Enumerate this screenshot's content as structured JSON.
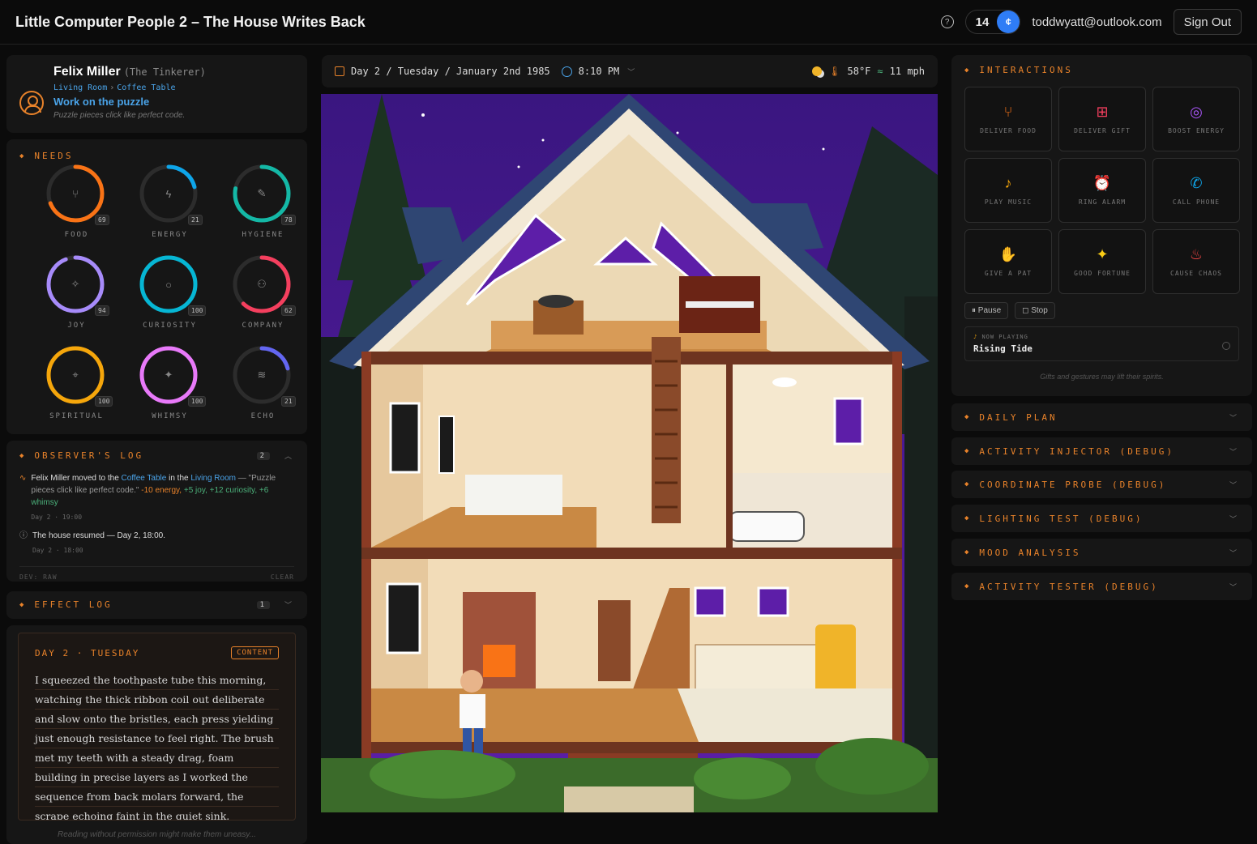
{
  "app": {
    "title": "Little Computer People 2 – The House Writes Back",
    "credits": "14",
    "coin_symbol": "¢",
    "email": "toddwyatt@outlook.com",
    "signout_label": "Sign Out"
  },
  "character": {
    "name": "Felix Miller",
    "role": "(The Tinkerer)",
    "room": "Living Room",
    "object": "Coffee Table",
    "task": "Work on the puzzle",
    "thought": "Puzzle pieces click like perfect code."
  },
  "needs": {
    "title": "NEEDS",
    "items": [
      {
        "label": "FOOD",
        "value": 69,
        "color": "#f97316",
        "icon": "⑂"
      },
      {
        "label": "ENERGY",
        "value": 21,
        "color": "#0ea5e9",
        "icon": "ϟ"
      },
      {
        "label": "HYGIENE",
        "value": 78,
        "color": "#14b8a6",
        "icon": "✎"
      },
      {
        "label": "JOY",
        "value": 94,
        "color": "#a78bfa",
        "icon": "✧"
      },
      {
        "label": "CURIOSITY",
        "value": 100,
        "color": "#06b6d4",
        "icon": "○"
      },
      {
        "label": "COMPANY",
        "value": 62,
        "color": "#f43f5e",
        "icon": "⚇"
      },
      {
        "label": "SPIRITUAL",
        "value": 100,
        "color": "#f5a60b",
        "icon": "⌖"
      },
      {
        "label": "WHIMSY",
        "value": 100,
        "color": "#e879f9",
        "icon": "✦"
      },
      {
        "label": "ECHO",
        "value": 21,
        "color": "#6366f1",
        "icon": "≋"
      }
    ]
  },
  "observer": {
    "title": "OBSERVER'S LOG",
    "count": "2",
    "entry1": {
      "actor": "Felix Miller",
      "moved": "moved to the",
      "object": "Coffee Table",
      "in": "in the",
      "room": "Living Room",
      "quote": "— \"Puzzle pieces click like perfect code.\"",
      "e1": "-10 energy,",
      "e2": "+5 joy,",
      "e3": "+12 curiosity,",
      "e4": "+6 whimsy",
      "time": "Day 2 · 19:00"
    },
    "entry2": {
      "text": "The house resumed — Day 2, 18:00.",
      "time": "Day 2 · 18:00"
    },
    "footer_left": "DEV: RAW",
    "footer_right": "CLEAR"
  },
  "effect_log": {
    "title": "EFFECT LOG",
    "count": "1"
  },
  "journal": {
    "heading": "DAY 2 · TUESDAY",
    "badge": "CONTENT",
    "text": "I squeezed the toothpaste tube this morning, watching the thick ribbon coil out deliberate and slow onto the bristles, each press yielding just enough resistance to feel right. The brush met my teeth with a steady drag, foam building in precise layers as I worked the sequence from back molars forward, the scrape echoing faint in the quiet sink.",
    "note": "Reading without permission might make them uneasy..."
  },
  "datebar": {
    "date": "Day 2 / Tuesday / January 2nd 1985",
    "time": "8:10 PM",
    "temp": "58°F",
    "wind": "11 mph"
  },
  "interactions": {
    "title": "INTERACTIONS",
    "buttons": [
      {
        "label": "DELIVER FOOD",
        "icon": "⑂",
        "color": "#f97316"
      },
      {
        "label": "DELIVER GIFT",
        "icon": "⊞",
        "color": "#f43f5e"
      },
      {
        "label": "BOOST ENERGY",
        "icon": "◎",
        "color": "#a855f7"
      },
      {
        "label": "PLAY MUSIC",
        "icon": "♪",
        "color": "#f5a60b"
      },
      {
        "label": "RING ALARM",
        "icon": "⏰",
        "color": "#ef4444"
      },
      {
        "label": "CALL PHONE",
        "icon": "✆",
        "color": "#0ea5e9"
      },
      {
        "label": "GIVE A PAT",
        "icon": "✋",
        "color": "#f43f5e"
      },
      {
        "label": "GOOD FORTUNE",
        "icon": "✦",
        "color": "#facc15"
      },
      {
        "label": "CAUSE CHAOS",
        "icon": "♨",
        "color": "#ef4444"
      }
    ],
    "pause_label": "Pause",
    "stop_label": "Stop",
    "now_playing_label": "NOW PLAYING",
    "now_playing_title": "Rising Tide",
    "note": "Gifts and gestures may lift their spirits."
  },
  "accordions": [
    "DAILY PLAN",
    "ACTIVITY INJECTOR (DEBUG)",
    "COORDINATE PROBE (DEBUG)",
    "LIGHTING TEST (DEBUG)",
    "MOOD ANALYSIS",
    "ACTIVITY TESTER (DEBUG)"
  ]
}
